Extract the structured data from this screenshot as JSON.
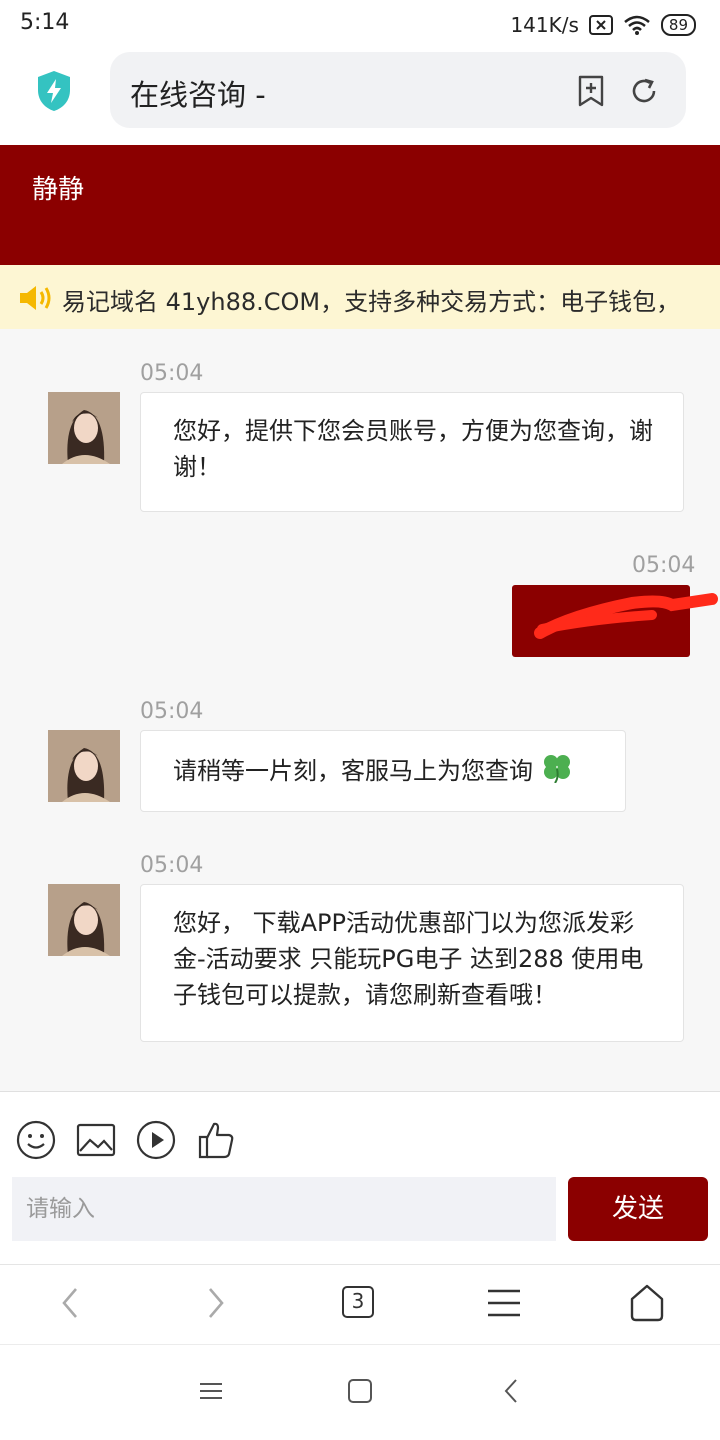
{
  "status_bar": {
    "time": "5:14",
    "net_speed": "141K/s",
    "battery": "89"
  },
  "browser": {
    "page_title": "在线咨询 -",
    "tab_count": "3"
  },
  "chat": {
    "agent_name": "静静",
    "notice": "易记域名 41yh88.COM，支持多种交易方式：电子钱包，",
    "messages": [
      {
        "time": "05:04",
        "text": "您好，提供下您会员账号，方便为您查询，谢谢！"
      },
      {
        "time": "05:04"
      },
      {
        "time": "05:04",
        "text": "请稍等一片刻，客服马上为您查询"
      },
      {
        "time": "05:04",
        "text": "您好， 下载APP活动优惠部门以为您派发彩金-活动要求 只能玩PG电子 达到288 使用电子钱包可以提款，请您刷新查看哦！"
      }
    ]
  },
  "composer": {
    "placeholder": "请输入",
    "send_label": "发送"
  },
  "colors": {
    "brand": "#8b0000",
    "notice_bg": "#fdf6d3",
    "clover": "#4caf50"
  },
  "icons": [
    "shield-icon",
    "bookmark-add-icon",
    "refresh-icon",
    "speaker-icon",
    "emoji-icon",
    "image-icon",
    "video-icon",
    "thumbs-up-icon",
    "back-icon",
    "forward-icon",
    "tabs-icon",
    "menu-icon",
    "home-icon",
    "recent-apps-icon",
    "home-square-icon",
    "system-back-icon"
  ]
}
